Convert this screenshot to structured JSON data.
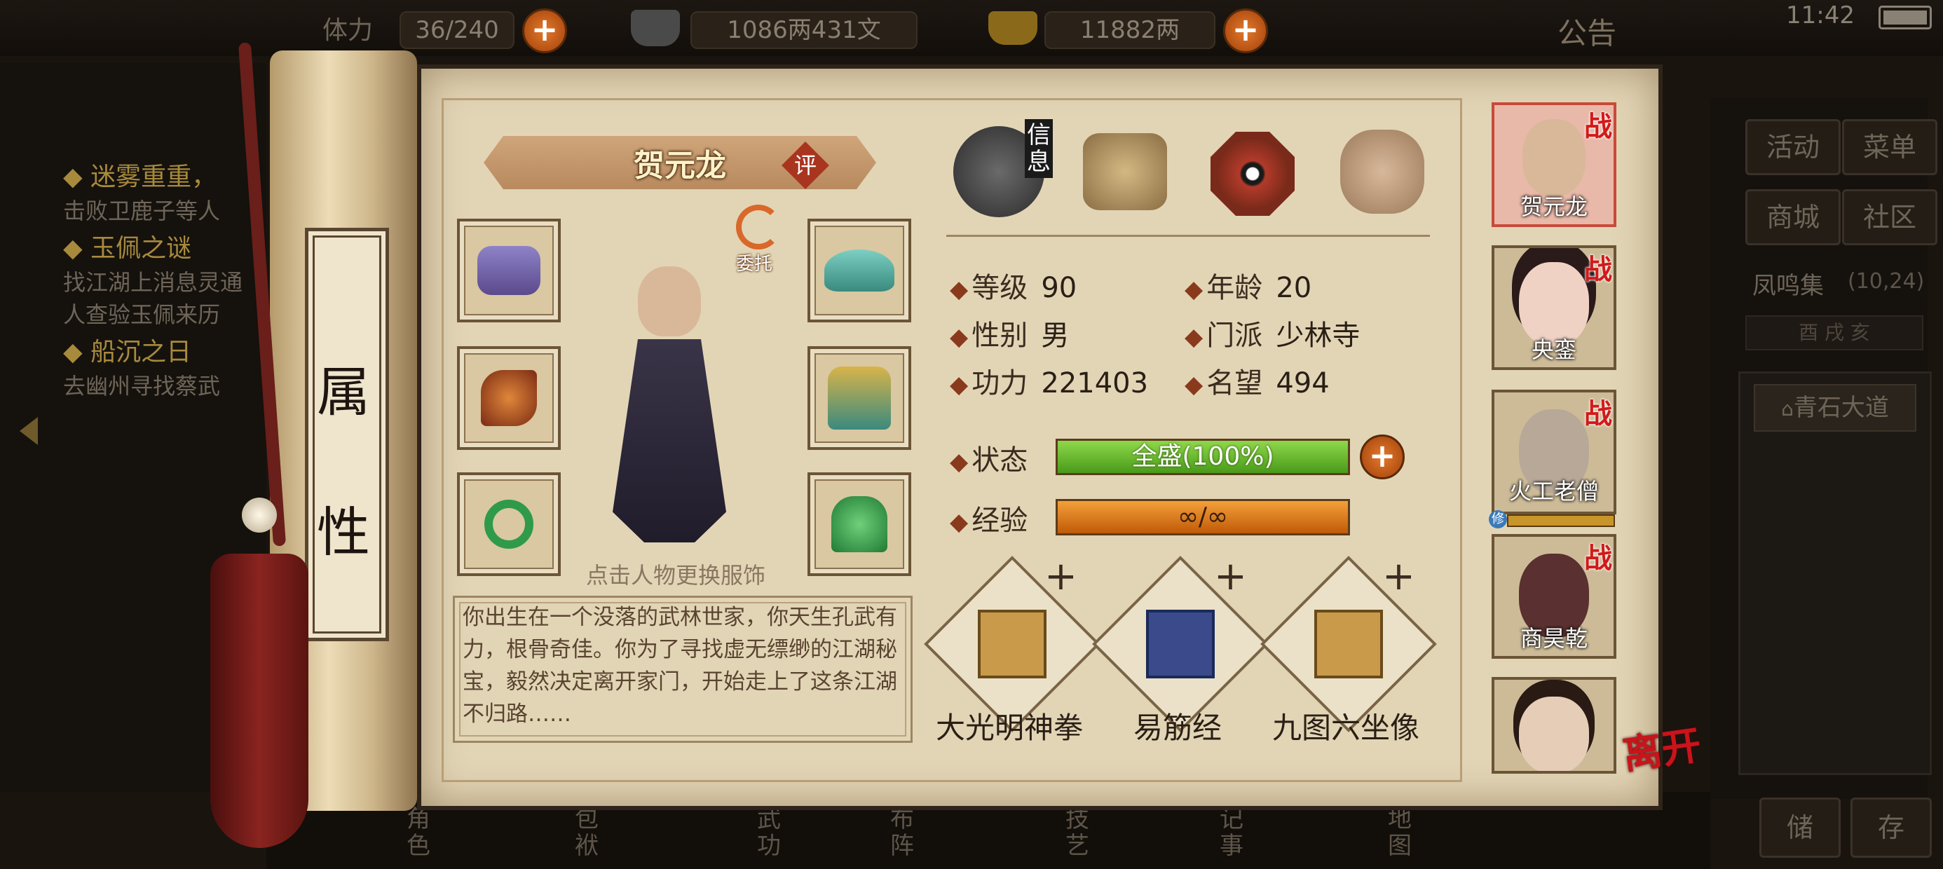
{
  "top": {
    "res1_value": "36/240",
    "res1_label": "体力",
    "silver": "1086两431文",
    "gold": "11882两",
    "notice": "公告",
    "time": "11:42",
    "plus": "+"
  },
  "quests": [
    {
      "title": "◆ 迷雾重重，",
      "desc": "击败卫鹿子等人"
    },
    {
      "title": "◆ 玉佩之谜",
      "desc": "找江湖上消息灵通\n人查验玉佩来历"
    },
    {
      "title": "◆ 船沉之日",
      "desc": "去幽州寻找蔡武"
    }
  ],
  "right_nav": {
    "buttons": [
      "活动",
      "菜单",
      "商城",
      "社区"
    ],
    "location": "凤鸣集",
    "coords": "(10,24)",
    "sub": "酉 戌 亥",
    "place": "青石大道",
    "bottom_buttons": [
      "储",
      "存"
    ]
  },
  "scroll": {
    "side_title_1": "属",
    "side_title_2": "性"
  },
  "hero": {
    "name": "贺元龙",
    "rate_badge": "评",
    "entrust": "委托",
    "change_hint": "点击人物更换服饰",
    "bio": "你出生在一个没落的武林世家，你天生孔武有力，根骨奇佳。你为了寻找虚无缥缈的江湖秘宝，毅然决定离开家门，开始走上了这条江湖不归路……"
  },
  "tabs": {
    "info_label": "信息"
  },
  "stats": {
    "level_label": "等级",
    "level": "90",
    "age_label": "年龄",
    "age": "20",
    "gender_label": "性别",
    "gender": "男",
    "sect_label": "门派",
    "sect": "少林寺",
    "power_label": "功力",
    "power": "221403",
    "fame_label": "名望",
    "fame": "494",
    "status_label": "状态",
    "status_text": "全盛(100%)",
    "status_fill": 1.0,
    "exp_label": "经验",
    "exp_text": "∞/∞",
    "exp_fill": 1.0
  },
  "skills": [
    {
      "name": "大光明神拳"
    },
    {
      "name": "易筋经"
    },
    {
      "name": "九图六坐像"
    }
  ],
  "party": [
    {
      "name": "贺元龙",
      "battle": "战"
    },
    {
      "name": "央銮",
      "battle": "战"
    },
    {
      "name": "火工老僧",
      "battle": "战",
      "tag": "修"
    },
    {
      "name": "商昊乾",
      "battle": "战"
    },
    {
      "name": "",
      "battle": ""
    }
  ],
  "leave": "离开",
  "bottom_tabs": [
    "角色",
    "包袱",
    "武功",
    "布阵",
    "技艺",
    "记事",
    "地图"
  ],
  "colors": {
    "status": "#6fbf2a",
    "exp": "#e57d10",
    "accent": "#d21a1a"
  }
}
